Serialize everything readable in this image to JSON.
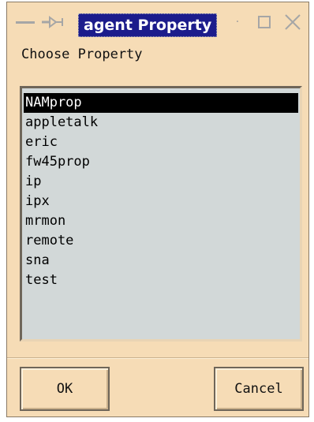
{
  "window": {
    "title": "agent Property",
    "prompt": "Choose Property"
  },
  "titlebar_icons": {
    "menu": "window-menu-icon",
    "pin": "pin-icon",
    "minimize": "minimize-icon",
    "maximize": "maximize-icon",
    "close": "close-icon",
    "pin_glyph": "−◁",
    "dot_glyph": "·",
    "close_glyph": "✕"
  },
  "list": {
    "selected_index": 0,
    "items": [
      "NAMprop",
      "appletalk",
      "eric",
      "fw45prop",
      "ip",
      "ipx",
      "mrmon",
      "remote",
      "sna",
      "test"
    ]
  },
  "buttons": {
    "ok": "OK",
    "cancel": "Cancel"
  },
  "colors": {
    "window_bg": "#f6dcb6",
    "title_bg": "#1c1c8c",
    "list_bg": "#d2d8d8",
    "selection_bg": "#000000"
  }
}
